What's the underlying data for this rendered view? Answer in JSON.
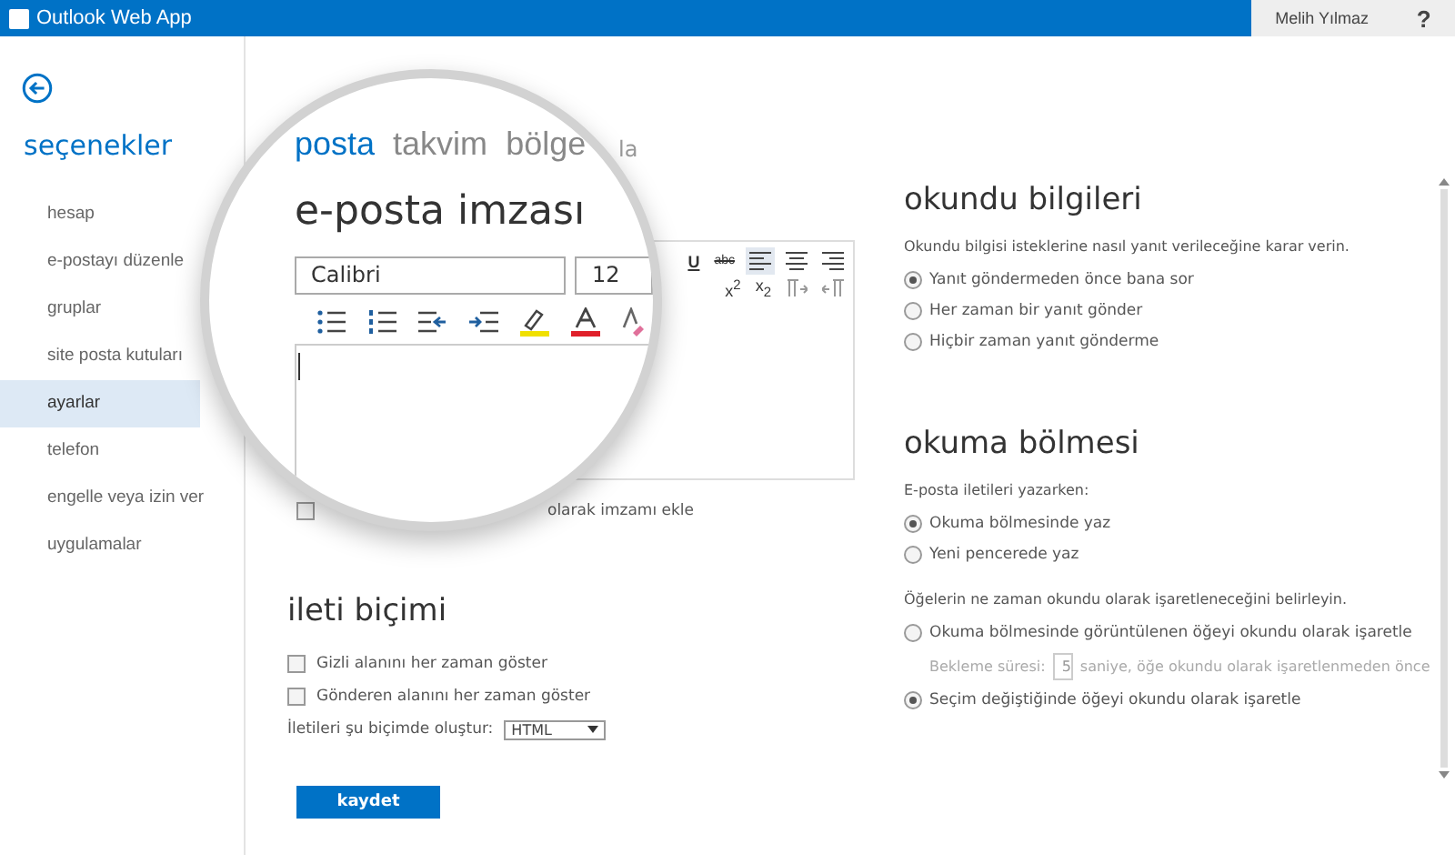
{
  "app_bar": {
    "title": "Outlook Web App",
    "user": "Melih Yılmaz",
    "help": "?"
  },
  "sidebar": {
    "title": "seçenekler",
    "items": [
      {
        "label": "hesap",
        "selected": false
      },
      {
        "label": "e-postayı düzenle",
        "selected": false
      },
      {
        "label": "gruplar",
        "selected": false
      },
      {
        "label": "site posta kutuları",
        "selected": false
      },
      {
        "label": "ayarlar",
        "selected": true
      },
      {
        "label": "telefon",
        "selected": false
      },
      {
        "label": "engelle veya izin ver",
        "selected": false
      },
      {
        "label": "uygulamalar",
        "selected": false
      }
    ]
  },
  "magnifier": {
    "tabs": [
      {
        "label": "posta",
        "selected": true
      },
      {
        "label": "takvim",
        "selected": false
      },
      {
        "label": "bölge",
        "selected": false
      }
    ],
    "heading": "e-posta imzası",
    "font": "Calibri",
    "size": "12"
  },
  "signature": {
    "tab_fragment": "la",
    "toolbar_row_1": [
      {
        "kind": "underline",
        "label": "U"
      },
      {
        "kind": "strikethrough",
        "label": "abc"
      },
      {
        "kind": "alignleft",
        "selected": true
      },
      {
        "kind": "aligncenter",
        "selected": false
      },
      {
        "kind": "alignright",
        "selected": false
      }
    ],
    "toolbar_row_2": [
      {
        "kind": "superscript",
        "label": "x$^{2}$"
      },
      {
        "kind": "subscript",
        "label": "x$_{2}$"
      },
      {
        "kind": "ltr",
        "selected": false
      },
      {
        "kind": "rtl",
        "selected": false
      }
    ],
    "option": {
      "label": "olarak imzamı ekle",
      "checked": false
    }
  },
  "message_format": {
    "heading": "ileti biçimi",
    "options": [
      {
        "label": "Gizli alanını her zaman göster",
        "checked": false
      },
      {
        "label": "Gönderen alanını her zaman göster",
        "checked": false
      }
    ],
    "compose_label": "İletileri şu biçimde oluştur:",
    "compose_value": "HTML"
  },
  "save_button": "kaydet",
  "read_receipts": {
    "heading": "okundu bilgileri",
    "description": "Okundu bilgisi isteklerine nasıl yanıt verileceğine karar verin.",
    "options": [
      {
        "label": "Yanıt göndermeden önce bana sor",
        "selected": true
      },
      {
        "label": "Her zaman bir yanıt gönder",
        "selected": false
      },
      {
        "label": "Hiçbir zaman yanıt gönderme",
        "selected": false
      }
    ]
  },
  "reading_pane": {
    "heading": "okuma bölmesi",
    "compose_prompt": "E-posta iletileri yazarken:",
    "compose_options": [
      {
        "label": "Okuma bölmesinde yaz",
        "selected": true
      },
      {
        "label": "Yeni pencerede yaz",
        "selected": false
      }
    ],
    "mark_prompt": "Öğelerin ne zaman okundu olarak işaretleneceğini belirleyin.",
    "mark_options": [
      {
        "kind": "radio",
        "label": "Okuma bölmesinde görüntülenen öğeyi okundu olarak işaretle",
        "selected": false
      },
      {
        "kind": "delay",
        "label": "Bekleme süresi:",
        "value": "5",
        "suffix": "saniye, öğe okundu olarak işaretlenmeden önce",
        "disabled": true
      },
      {
        "kind": "radio",
        "label": "Seçim değiştiğinde öğeyi okundu olarak işaretle",
        "selected": true
      }
    ]
  }
}
